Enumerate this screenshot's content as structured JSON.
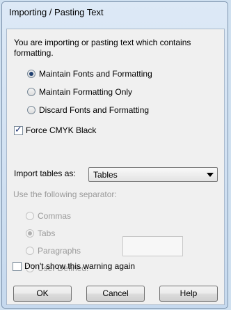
{
  "title": "Importing / Pasting Text",
  "message": "You are importing or pasting text which contains formatting.",
  "format_options": [
    {
      "label": "Maintain Fonts and Formatting",
      "selected": true
    },
    {
      "label": "Maintain Formatting Only",
      "selected": false
    },
    {
      "label": "Discard Fonts and Formatting",
      "selected": false
    }
  ],
  "force_cmyk": {
    "label": "Force CMYK Black",
    "checked": true
  },
  "import_tables": {
    "label": "Import tables as:",
    "value": "Tables"
  },
  "separator": {
    "label": "Use the following separator:",
    "options": [
      {
        "label": "Commas",
        "selected": false
      },
      {
        "label": "Tabs",
        "selected": true
      },
      {
        "label": "Paragraphs",
        "selected": false
      },
      {
        "label": "User Defined:",
        "selected": false
      }
    ],
    "user_defined_value": ""
  },
  "dont_show": {
    "label": "Don't show this warning again",
    "checked": false
  },
  "buttons": {
    "ok": "OK",
    "cancel": "Cancel",
    "help": "Help"
  }
}
